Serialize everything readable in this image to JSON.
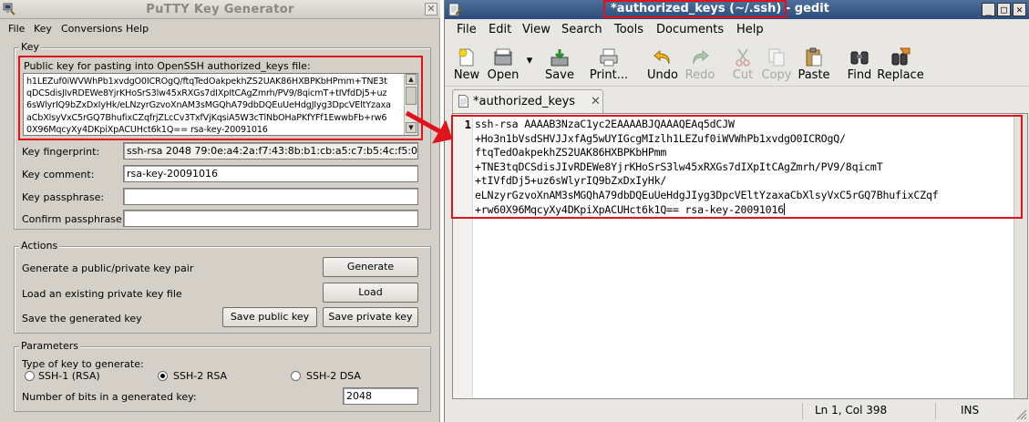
{
  "colors": {
    "annotation_red": "#e0121c",
    "putty_face": "#d4d0c8",
    "gedit_titlebar": "#2c4d7b"
  },
  "putty": {
    "title": "PuTTY Key Generator",
    "menu": [
      "File",
      "Key",
      "Conversions",
      "Help"
    ],
    "key_group_label": "Key",
    "public_key_label": "Public key for pasting into OpenSSH authorized_keys file:",
    "public_key_lines": [
      "h1LEZuf0iWVWhPb1xvdgO0ICROgQ/ftqTedOakpekhZS2UAK86HXBPKbHPmm+TNE3t",
      "qDCSdisJIvRDEWe8YjrKHoSrS3lw45xRXGs7dIXpItCAgZmrh/PV9/8qicmT+tIVfdDj5+uz",
      "6sWlyrIQ9bZxDxIyHk/eLNzyrGzvoXnAM3sMGQhA79dbDQEuUeHdgJIyg3DpcVEltYzaxa",
      "aCbXlsyVxC5rGQ7BhufixCZqfrjZLcCv3TxfVjKqsiA5W3cTlNbOHaPKfYFf1EwwbFb+rw6",
      "0X96MqcyXy4DKpiXpACUHct6k1Q== rsa-key-20091016"
    ],
    "fingerprint_label": "Key fingerprint:",
    "fingerprint_value": "ssh-rsa 2048 79:0e:a4:2a:f7:43:8b:b1:cb:a5:c7:b5:4c:f5:0f:35",
    "comment_label": "Key comment:",
    "comment_value": "rsa-key-20091016",
    "passphrase_label": "Key passphrase:",
    "passphrase_value": "",
    "confirm_label": "Confirm passphrase:",
    "confirm_value": "",
    "actions_label": "Actions",
    "generate_text": "Generate a public/private key pair",
    "generate_btn": "Generate",
    "load_text": "Load an existing private key file",
    "load_btn": "Load",
    "save_text": "Save the generated key",
    "save_public_btn": "Save public key",
    "save_private_btn": "Save private key",
    "params_label": "Parameters",
    "type_label": "Type of key to generate:",
    "key_types": [
      "SSH-1 (RSA)",
      "SSH-2 RSA",
      "SSH-2 DSA"
    ],
    "selected_key_type": "SSH-2 RSA",
    "bits_label": "Number of bits in a generated key:",
    "bits_value": "2048"
  },
  "gedit": {
    "title_file": "*authorized_keys (~/.ssh)",
    "title_app": " - gedit",
    "menu": [
      "File",
      "Edit",
      "View",
      "Search",
      "Tools",
      "Documents",
      "Help"
    ],
    "toolbar": {
      "new": "New",
      "open": "Open",
      "save": "Save",
      "print": "Print...",
      "undo": "Undo",
      "redo": "Redo",
      "cut": "Cut",
      "copy": "Copy",
      "paste": "Paste",
      "find": "Find",
      "replace": "Replace"
    },
    "tab_label": "*authorized_keys",
    "line_number": "1",
    "code_lines": [
      "ssh-rsa AAAAB3NzaC1yc2EAAAABJQAAAQEAq5dCJW",
      "+Ho3n1bVsdSHVJJxfAg5wUYIGcgMIzlh1LEZuf0iWVWhPb1xvdgO0ICROgQ/",
      "ftqTedOakpekhZS2UAK86HXBPKbHPmm",
      "+TNE3tqDCSdisJIvRDEWe8YjrKHoSrS3lw45xRXGs7dIXpItCAgZmrh/PV9/8qicmT",
      "+tIVfdDj5+uz6sWlyrIQ9bZxDxIyHk/",
      "eLNzyrGzvoXnAM3sMGQhA79dbDQEuUeHdgJIyg3DpcVEltYzaxaCbXlsyVxC5rGQ7BhufixCZqf",
      "+rw60X96MqcyXy4DKpiXpACUHct6k1Q== rsa-key-20091016"
    ],
    "status_position": "Ln 1, Col 398",
    "status_mode": "INS"
  }
}
